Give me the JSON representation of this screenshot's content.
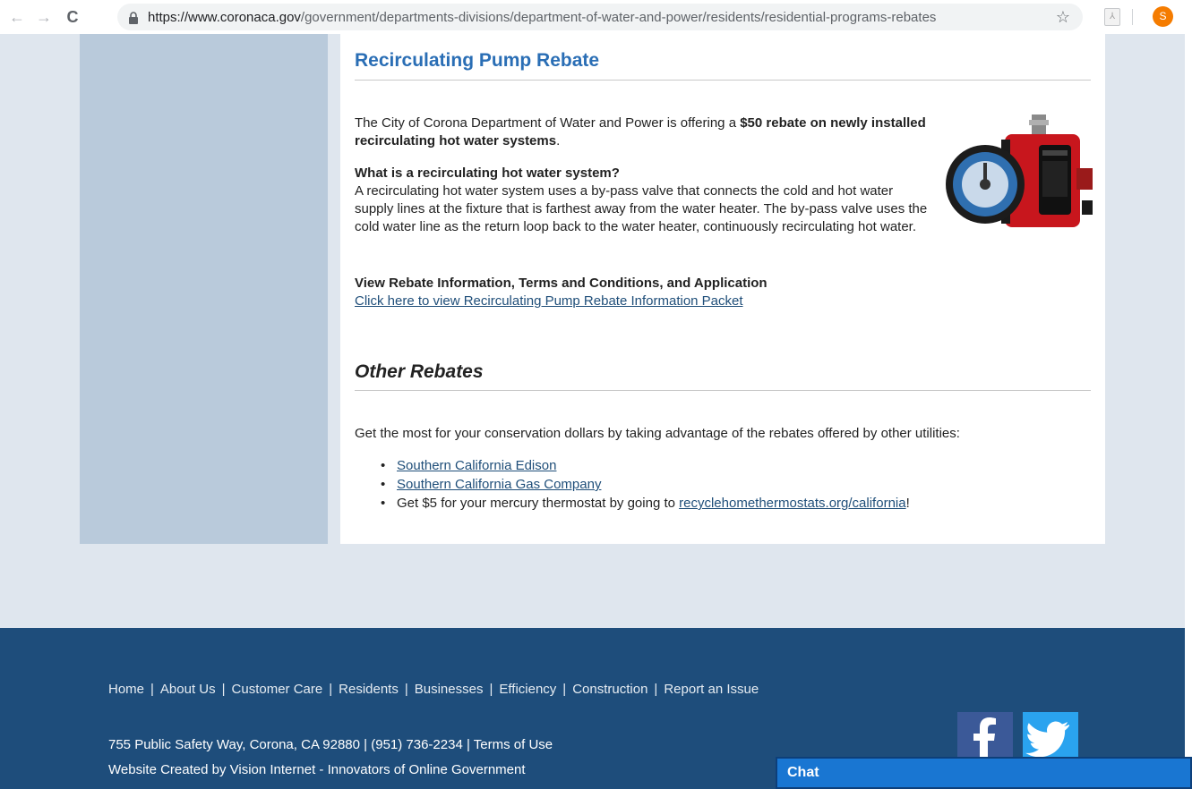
{
  "browser": {
    "url_host": "https://www.coronaca.gov",
    "url_path": "/government/departments-divisions/department-of-water-and-power/residents/residential-programs-rebates",
    "profile_initial": "S"
  },
  "pump_rebate": {
    "title": "Recirculating Pump Rebate",
    "intro_prefix": "The City of Corona Department of Water and Power is offering a ",
    "intro_bold": "$50 rebate on newly installed recirculating hot water systems",
    "intro_suffix": ".",
    "question": "What is a recirculating hot water system?",
    "answer": "A recirculating hot water system uses a by-pass valve that connects the cold and hot water supply lines at the fixture that is farthest away from the water heater. The by-pass valve uses the cold water line as the return loop back to the water heater, continuously recirculating hot water.",
    "terms_heading": "View Rebate Information, Terms and Conditions, and Application",
    "packet_link": "Click here to view Recirculating Pump Rebate Information Packet"
  },
  "other_rebates": {
    "title": "Other Rebates",
    "intro": "Get the most for your conservation dollars by taking advantage of the rebates offered by other utilities:",
    "links": [
      "Southern California Edison",
      "Southern California Gas Company"
    ],
    "thermostat_prefix": "Get $5 for your mercury thermostat by going to ",
    "thermostat_link": "recyclehomethermostats.org/california",
    "thermostat_suffix": "!"
  },
  "footer": {
    "nav": [
      "Home",
      "About Us",
      "Customer Care",
      "Residents",
      "Businesses",
      "Efficiency",
      "Construction",
      "Report an Issue"
    ],
    "address": "755 Public Safety Way, Corona, CA 92880 | (951) 736-2234 | Terms of Use",
    "credit": "Website Created by Vision Internet - Innovators of Online Government"
  },
  "chat": {
    "label": "Chat"
  },
  "colors": {
    "heading_blue": "#2a6eb5",
    "footer_bg": "#1e4d7b",
    "facebook": "#3b5998",
    "twitter": "#2aa3ef",
    "chat_bg": "#1976d2"
  }
}
